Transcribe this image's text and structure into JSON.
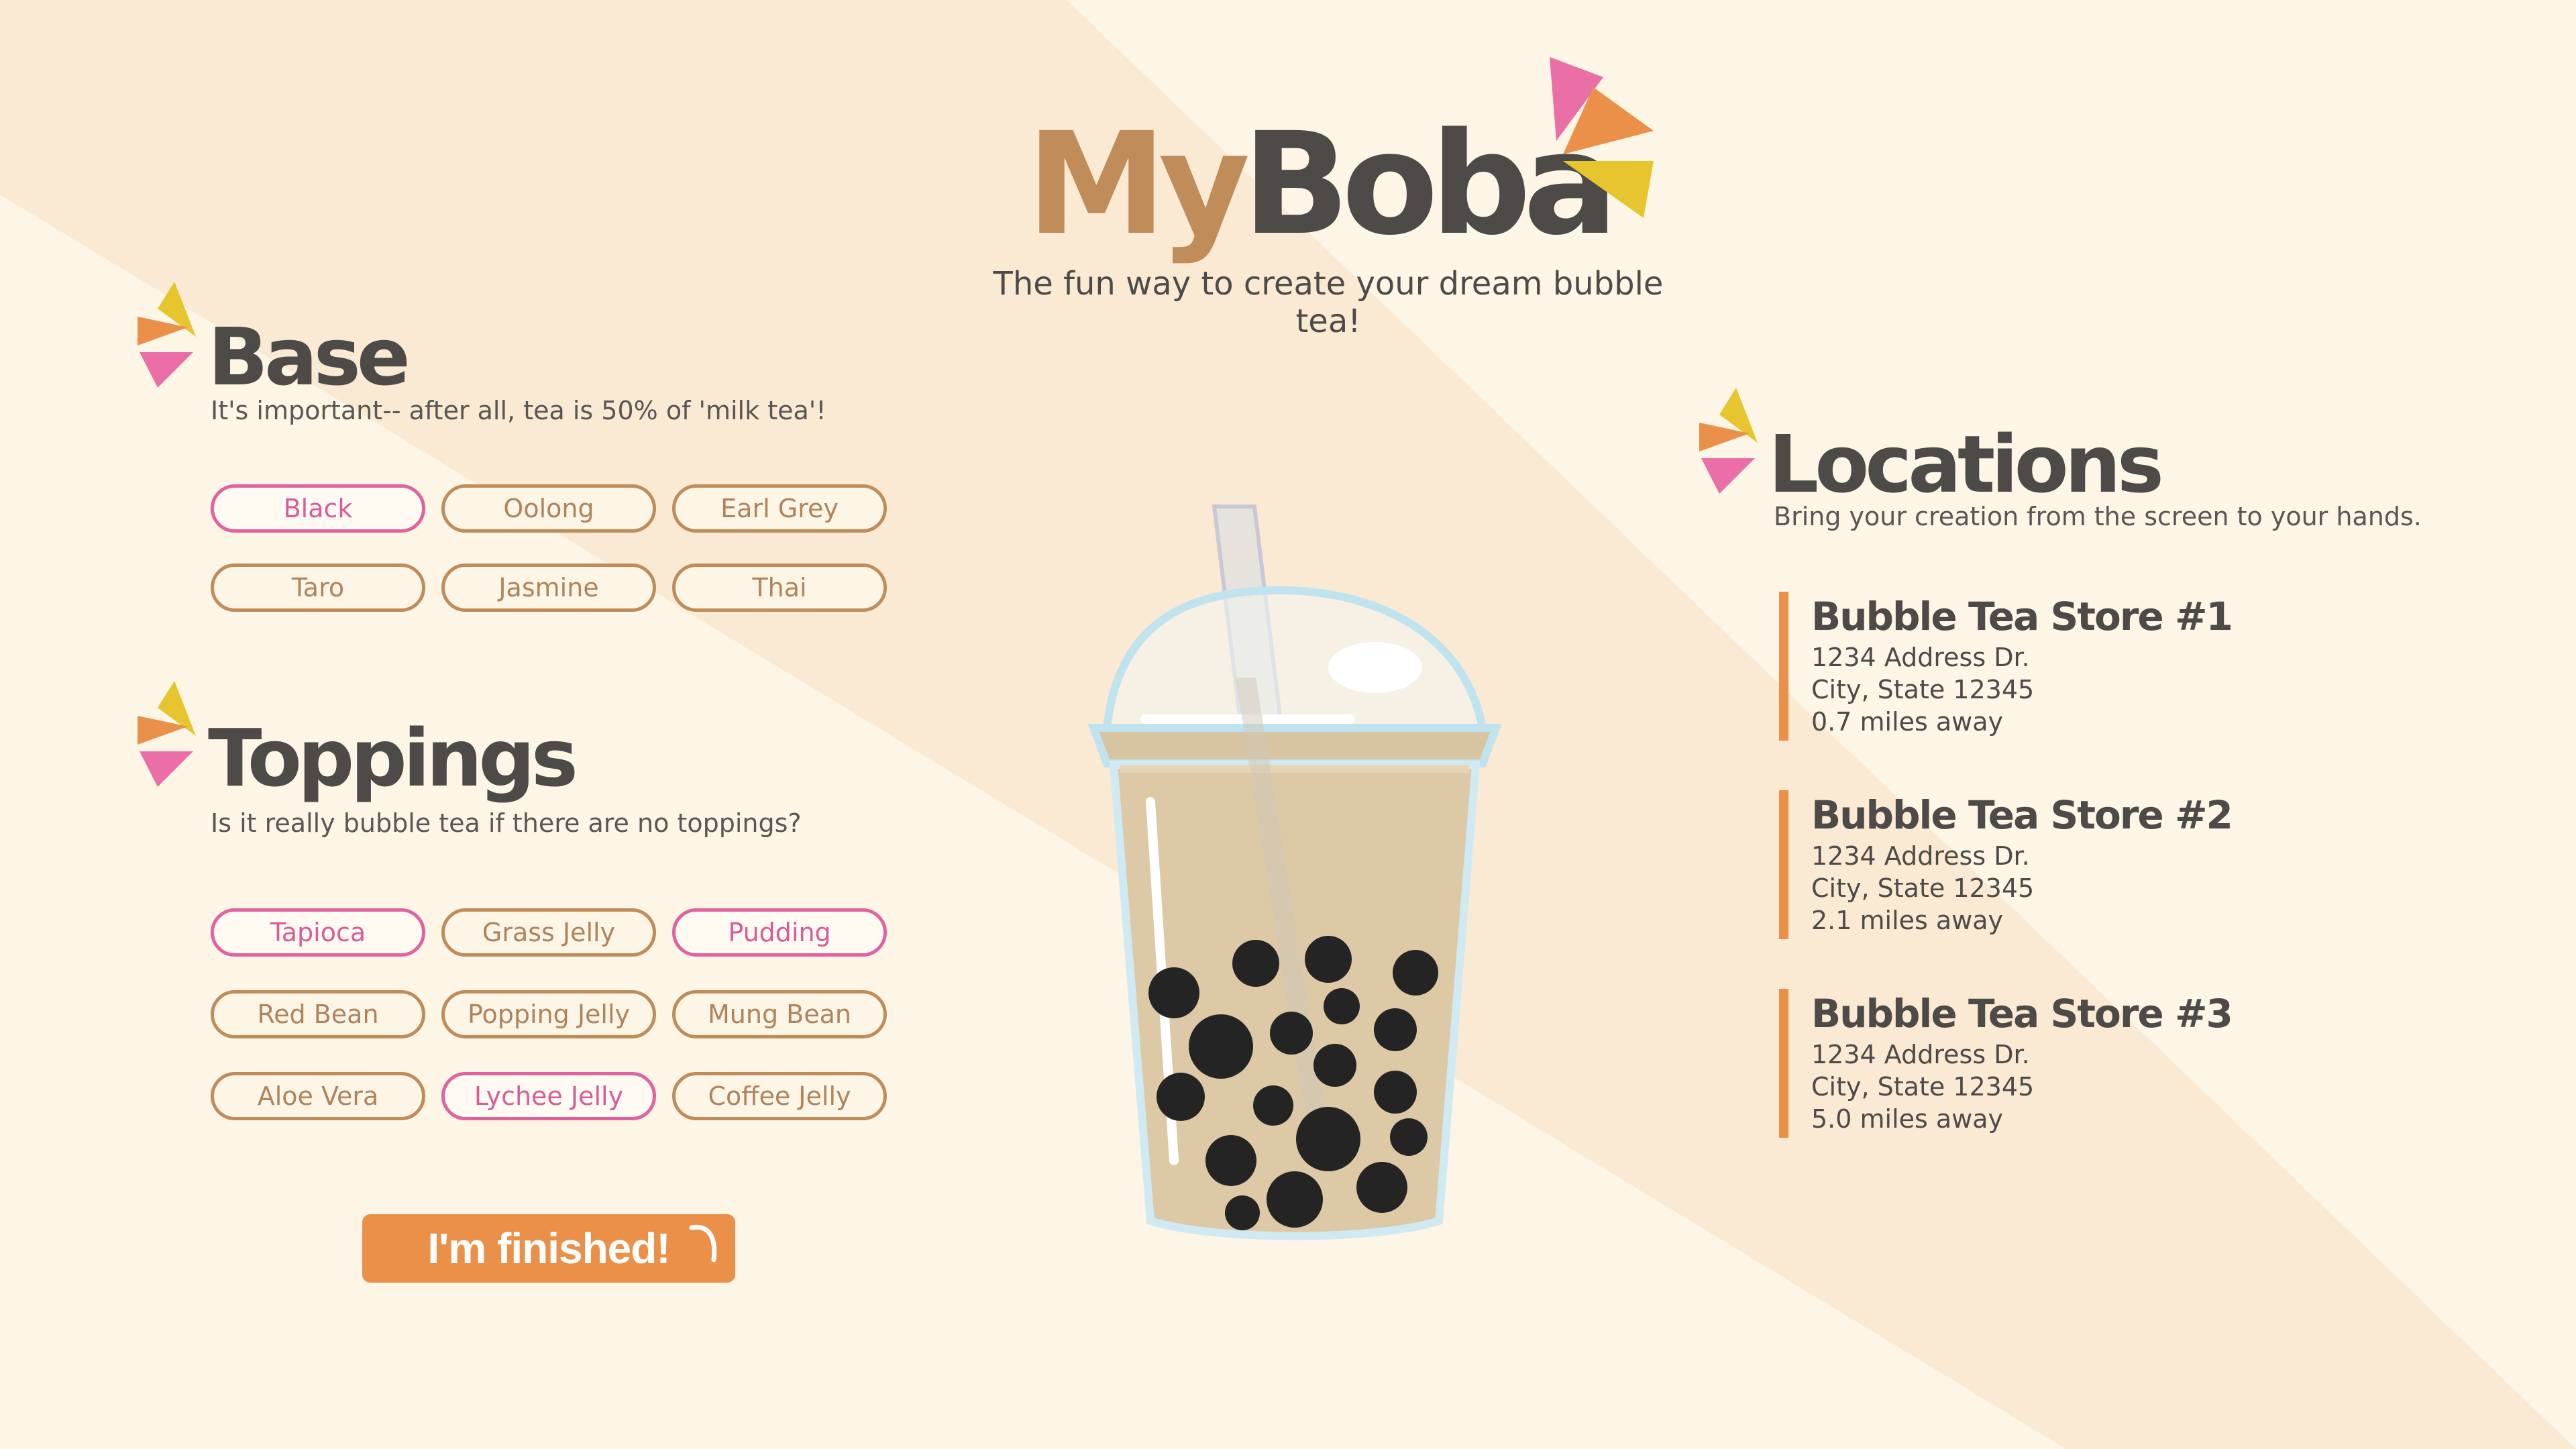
{
  "app": {
    "logo_my": "My",
    "logo_boba": "Boba",
    "tagline": "The fun way to create your dream bubble tea!"
  },
  "colors": {
    "background": "#fdf5e6",
    "accent_orange": "#ea9048",
    "accent_pink": "#e262a0",
    "accent_yellow": "#e6c52f",
    "brown": "#c08c5a",
    "dark_text": "#4d4a48"
  },
  "base": {
    "title": "Base",
    "subtitle": "It's important-- after all, tea is 50% of 'milk tea'!",
    "options": [
      {
        "label": "Black",
        "selected": true
      },
      {
        "label": "Oolong",
        "selected": false
      },
      {
        "label": "Earl Grey",
        "selected": false
      },
      {
        "label": "Taro",
        "selected": false
      },
      {
        "label": "Jasmine",
        "selected": false
      },
      {
        "label": "Thai",
        "selected": false
      }
    ]
  },
  "toppings": {
    "title": "Toppings",
    "subtitle": "Is it really bubble tea if there are no toppings?",
    "options": [
      {
        "label": "Tapioca",
        "selected": true
      },
      {
        "label": "Grass Jelly",
        "selected": false
      },
      {
        "label": "Pudding",
        "selected": true
      },
      {
        "label": "Red Bean",
        "selected": false
      },
      {
        "label": "Popping Jelly",
        "selected": false
      },
      {
        "label": "Mung Bean",
        "selected": false
      },
      {
        "label": "Aloe Vera",
        "selected": false
      },
      {
        "label": "Lychee Jelly",
        "selected": true
      },
      {
        "label": "Coffee Jelly",
        "selected": false
      }
    ]
  },
  "finish_button": "I'm finished!",
  "locations": {
    "title": "Locations",
    "subtitle": "Bring your creation from the screen to your hands.",
    "stores": [
      {
        "name": "Bubble Tea Store #1",
        "address": "1234 Address Dr.",
        "city": "City, State 12345",
        "distance": "0.7 miles away"
      },
      {
        "name": "Bubble Tea Store #2",
        "address": "1234 Address Dr.",
        "city": "City, State 12345",
        "distance": "2.1 miles away"
      },
      {
        "name": "Bubble Tea Store #3",
        "address": "1234 Address Dr.",
        "city": "City, State 12345",
        "distance": "5.0 miles away"
      }
    ]
  },
  "icons": {
    "section_fan": "pinwheel-icon",
    "logo_fan": "pinwheel-icon"
  }
}
